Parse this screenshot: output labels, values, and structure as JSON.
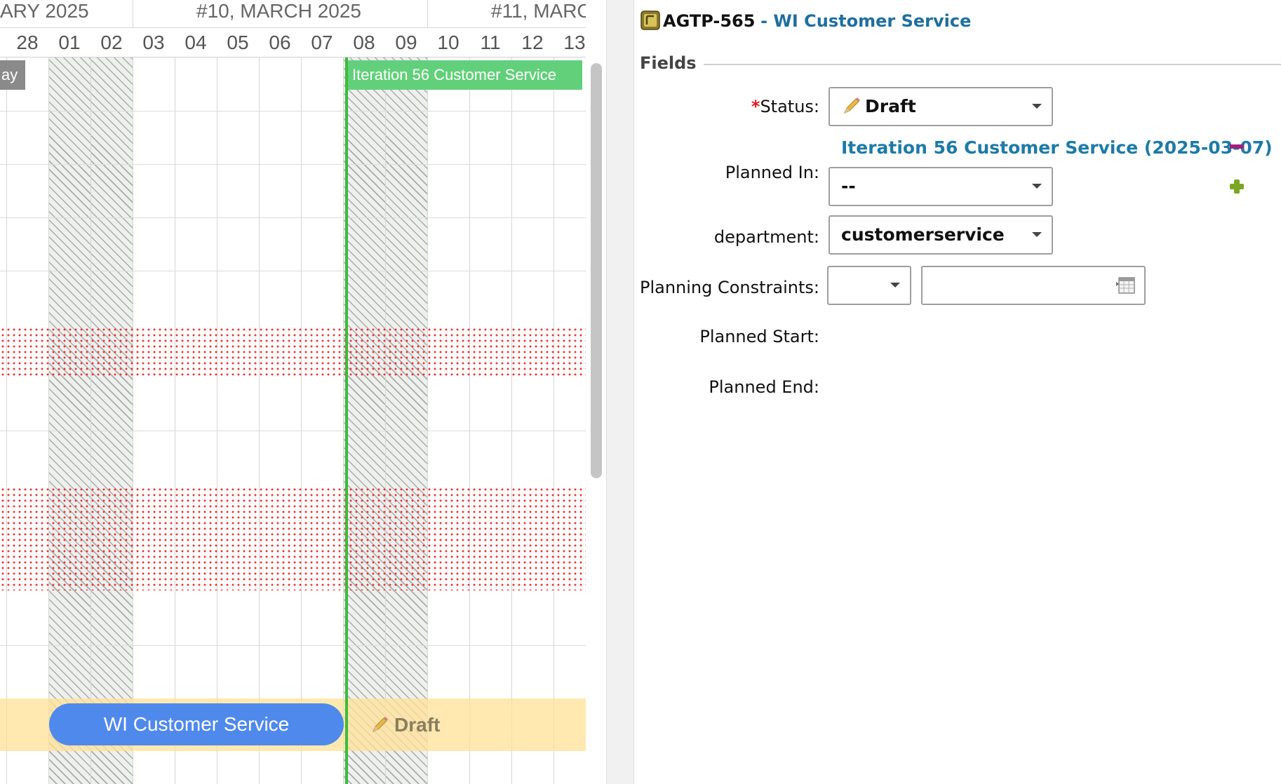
{
  "gantt": {
    "weeks": [
      {
        "label": "ARY 2025"
      },
      {
        "label": "#10, MARCH 2025"
      },
      {
        "label": "#11, MARC"
      }
    ],
    "days": [
      "28",
      "01",
      "02",
      "03",
      "04",
      "05",
      "06",
      "07",
      "08",
      "09",
      "10",
      "11",
      "12",
      "13"
    ],
    "bars": {
      "gray_label": "ay",
      "iteration_label": "Iteration 56 Customer Service"
    },
    "work_item": {
      "bar_label": "WI Customer Service",
      "status_label": "Draft",
      "status_icon": "pencil-icon",
      "band_color": "#ffe9a8",
      "bar_color": "#5089ec"
    },
    "colors": {
      "today_line": "#3dbb3d",
      "iteration_bar": "#62d07a",
      "blocked_pattern": "#ee3333"
    }
  },
  "detail": {
    "item_key": "AGTP-565",
    "item_title": "- WI Customer Service",
    "item_icon": "work-item-icon",
    "section_label": "Fields",
    "fields": {
      "status": {
        "required_mark": "*",
        "label": "Status:",
        "value": "Draft",
        "icon": "pencil-icon"
      },
      "planned_in": {
        "label": "Planned In:",
        "linked_iteration": "Iteration 56 Customer Service (2025-03-07)",
        "value": "--"
      },
      "department": {
        "label": "department:",
        "value": "customerservice"
      },
      "planning_constraints": {
        "label": "Planning Constraints:",
        "type_value": "",
        "date_value": "",
        "date_icon": "calendar-icon"
      },
      "planned_start": {
        "label": "Planned Start:",
        "value": ""
      },
      "planned_end": {
        "label": "Planned End:",
        "value": ""
      }
    },
    "colors": {
      "title_link": "#1e6f9e",
      "required": "#e01a1a",
      "remove_icon": "#a0207c",
      "add_icon": "#7aa624"
    }
  }
}
